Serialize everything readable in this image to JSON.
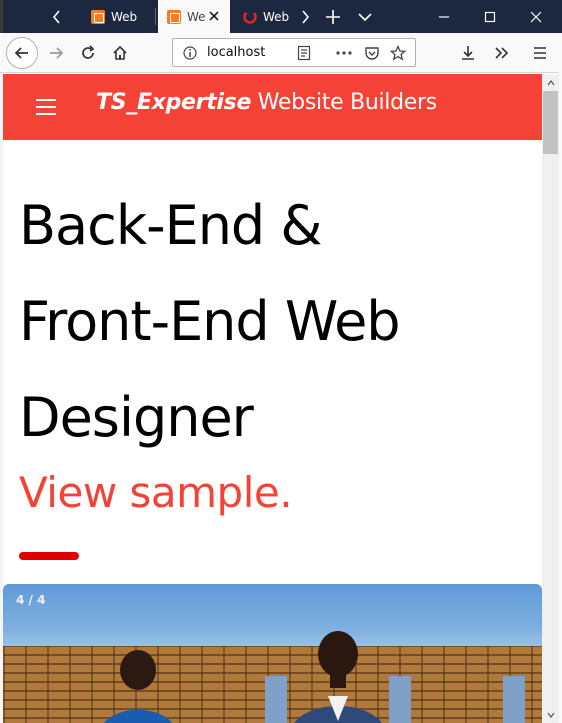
{
  "browser": {
    "tabs": [
      {
        "title": "Web",
        "favicon": "xampp-icon",
        "active": false
      },
      {
        "title": "We",
        "favicon": "xampp-icon",
        "active": true
      },
      {
        "title": "Web",
        "favicon": "red-app-icon",
        "active": false
      }
    ],
    "url": "localhost"
  },
  "site": {
    "header_brand": "TS_Expertise",
    "header_title": "Website Builders",
    "header_color": "#f44336"
  },
  "hero": {
    "line1": "Back-End &",
    "line2": "Front-End Web",
    "line3": "Designer",
    "link_text": "View sample.",
    "accent_color": "#e00000"
  },
  "slideshow": {
    "counter": "4 / 4"
  }
}
